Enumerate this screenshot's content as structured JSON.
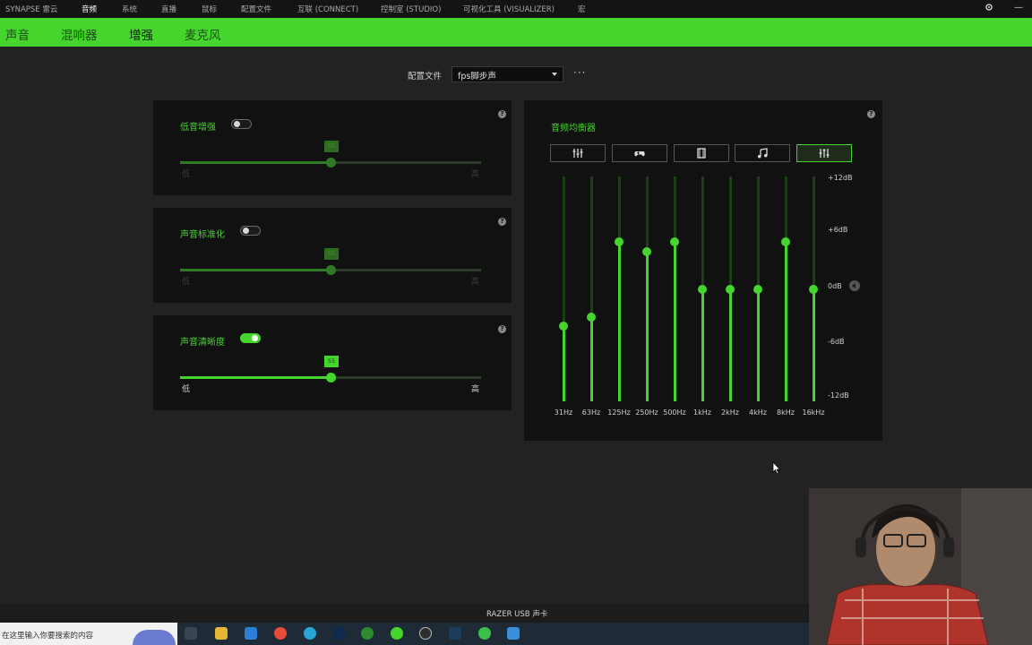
{
  "topnav": {
    "items": [
      {
        "label": "SYNAPSE 雷云",
        "active": false
      },
      {
        "label": "音频",
        "active": true
      },
      {
        "label": "系统",
        "active": false
      },
      {
        "label": "直播",
        "active": false
      },
      {
        "label": "鼠标",
        "active": false
      },
      {
        "label": "配置文件",
        "active": false
      },
      {
        "label": "互联 (CONNECT)",
        "active": false
      },
      {
        "label": "控制室 (STUDIO)",
        "active": false
      },
      {
        "label": "可视化工具 (VISUALIZER)",
        "active": false
      },
      {
        "label": "宏",
        "active": false
      }
    ],
    "settings_icon": "gear-icon",
    "minimize_label": "—"
  },
  "subnav": {
    "items": [
      {
        "label": "声音",
        "active": false
      },
      {
        "label": "混响器",
        "active": false
      },
      {
        "label": "增强",
        "active": true
      },
      {
        "label": "麦克风",
        "active": false
      }
    ]
  },
  "profile": {
    "label": "配置文件",
    "value": "fps脚步声",
    "more": "···"
  },
  "enhancements": [
    {
      "title": "低音增强",
      "enabled": false,
      "value": 55,
      "bubble": "55",
      "low_label": "低",
      "high_label": "高"
    },
    {
      "title": "声音标准化",
      "enabled": false,
      "value": 55,
      "bubble": "55",
      "low_label": "低",
      "high_label": "高"
    },
    {
      "title": "声音清晰度",
      "enabled": true,
      "value": 55,
      "bubble": "55",
      "low_label": "低",
      "high_label": "高"
    }
  ],
  "equalizer": {
    "title": "音频均衡器",
    "presets": [
      {
        "icon": "sliders-icon",
        "active": false
      },
      {
        "icon": "gamepad-icon",
        "active": false
      },
      {
        "icon": "film-icon",
        "active": false
      },
      {
        "icon": "music-note-icon",
        "active": false
      },
      {
        "icon": "custom-sliders-icon",
        "active": true
      }
    ],
    "db_labels": [
      "+12dB",
      "+6dB",
      "0dB",
      "-6dB",
      "-12dB"
    ],
    "bands": [
      {
        "freq": "31Hz",
        "db": -4
      },
      {
        "freq": "63Hz",
        "db": -3
      },
      {
        "freq": "125Hz",
        "db": 5
      },
      {
        "freq": "250Hz",
        "db": 4
      },
      {
        "freq": "500Hz",
        "db": 5
      },
      {
        "freq": "1kHz",
        "db": 0
      },
      {
        "freq": "2kHz",
        "db": 0
      },
      {
        "freq": "4kHz",
        "db": 0
      },
      {
        "freq": "8kHz",
        "db": 5
      },
      {
        "freq": "16kHz",
        "db": 0
      }
    ],
    "db_range": [
      -12,
      12
    ]
  },
  "device": {
    "name": "RAZER USB 声卡"
  },
  "taskbar": {
    "search_placeholder": "在这里输入你要搜索的内容",
    "apps": [
      "task-view-icon",
      "file-explorer-icon",
      "mail-icon",
      "chrome-icon",
      "edge-icon",
      "photoshop-icon",
      "xbox-icon",
      "razer-icon",
      "obs-icon",
      "steam-icon",
      "wechat-icon",
      "photos-icon"
    ]
  }
}
